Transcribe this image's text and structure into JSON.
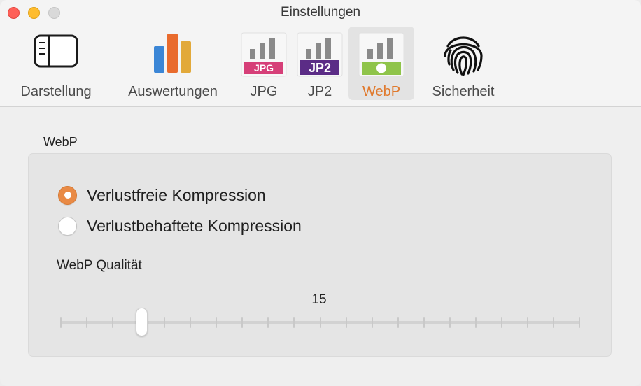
{
  "window": {
    "title": "Einstellungen",
    "controls": [
      "close",
      "minimize",
      "zoom"
    ]
  },
  "toolbar": {
    "tabs": [
      {
        "id": "darstellung",
        "label": "Darstellung",
        "icon": "sidebar-panel-icon",
        "selected": false
      },
      {
        "id": "auswertungen",
        "label": "Auswertungen",
        "icon": "bar-chart-icon",
        "selected": false
      },
      {
        "id": "jpg",
        "label": "JPG",
        "icon": "jpg-file-icon",
        "badge": "JPG",
        "selected": false
      },
      {
        "id": "jp2",
        "label": "JP2",
        "icon": "jp2-file-icon",
        "badge": "JP2",
        "selected": false
      },
      {
        "id": "webp",
        "label": "WebP",
        "icon": "webp-file-icon",
        "selected": true
      },
      {
        "id": "sicherheit",
        "label": "Sicherheit",
        "icon": "fingerprint-icon",
        "selected": false
      }
    ]
  },
  "colors": {
    "accent": "#e07a2e",
    "radio_on": "#e98a45",
    "jpg_badge": "#d63f78",
    "jp2_badge": "#5b2c86",
    "webp_badge": "#8fc44a",
    "chart_blue": "#3b86d6",
    "chart_orange": "#e96b2d",
    "chart_gold": "#e2a93a"
  },
  "webp": {
    "group_label": "WebP",
    "options": [
      {
        "label": "Verlustfreie Kompression",
        "selected": true
      },
      {
        "label": "Verlustbehaftete Kompression",
        "selected": false
      }
    ],
    "quality_label": "WebP Qualität",
    "quality_value": "15",
    "quality_fraction": 0.156,
    "tick_count": 21
  }
}
